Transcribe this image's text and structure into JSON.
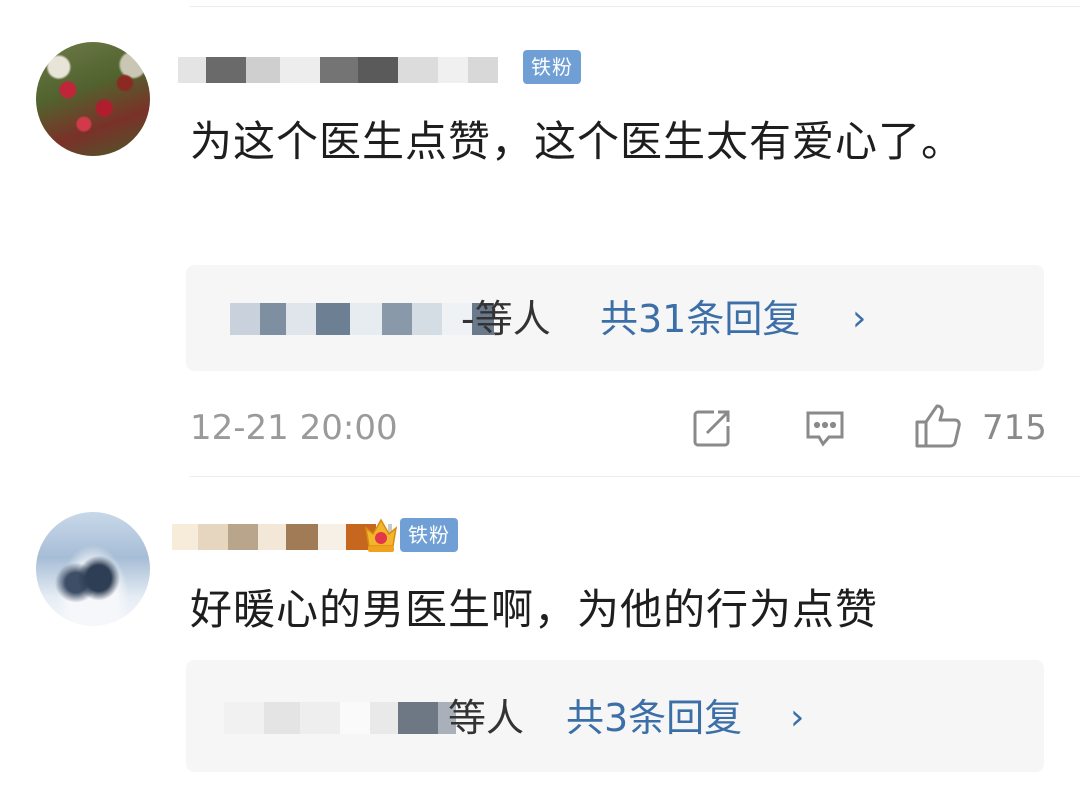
{
  "comments": [
    {
      "badge": "铁粉",
      "text": "为这个医生点赞，这个医生太有爱心了。",
      "replies": {
        "suffix": "-等人",
        "count_label": "共31条回复",
        "chevron": "›"
      },
      "timestamp": "12-21 20:00",
      "likes": "715"
    },
    {
      "badge": "铁粉",
      "text": "好暖心的男医生啊，为他的行为点赞",
      "replies": {
        "suffix": "等人",
        "count_label": "共3条回复",
        "chevron": "›"
      }
    }
  ],
  "icons": {
    "share": "share-icon",
    "comment": "comment-icon",
    "like": "thumbs-up-icon",
    "crown": "crown-icon"
  },
  "colors": {
    "link": "#3c6fa8",
    "badge": "#6f9fd4",
    "muted": "#9a9a9a"
  }
}
